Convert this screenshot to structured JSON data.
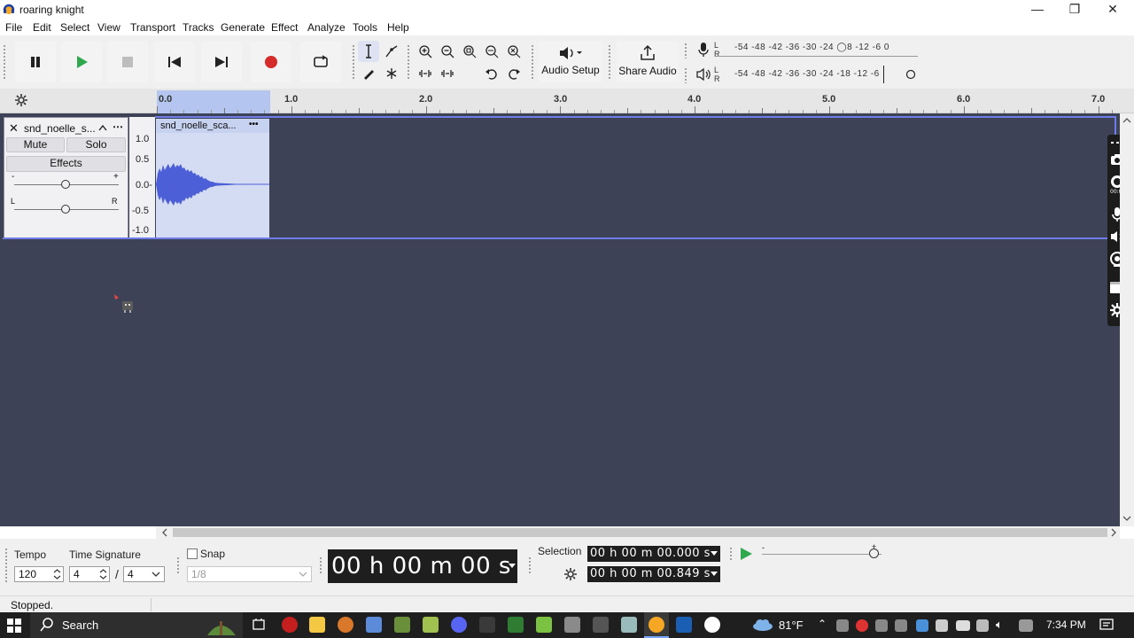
{
  "window": {
    "title": "roaring knight",
    "min": "—",
    "max": "❐",
    "close": "✕"
  },
  "menu": [
    "File",
    "Edit",
    "Select",
    "View",
    "Transport",
    "Tracks",
    "Generate",
    "Effect",
    "Analyze",
    "Tools",
    "Help"
  ],
  "toolbar": {
    "audio_setup": "Audio Setup",
    "share_audio": "Share Audio"
  },
  "meters": {
    "record": {
      "channels": "L R",
      "scale": "-54 -48 -42 -36 -30 -24 ◯8 -12 -6 0"
    },
    "playback": {
      "channels": "L R",
      "scale": "-54 -48 -42 -36 -30 -24 -18 -12 -6"
    }
  },
  "ruler": [
    "0.0",
    "1.0",
    "2.0",
    "3.0",
    "4.0",
    "5.0",
    "6.0",
    "7.0"
  ],
  "track": {
    "name": "snd_noelle_s...",
    "mute": "Mute",
    "solo": "Solo",
    "effects": "Effects",
    "gain_minus": "-",
    "gain_plus": "+",
    "pan_left": "L",
    "pan_right": "R",
    "scale": [
      "1.0",
      "0.5",
      "0.0-",
      "-0.5",
      "-1.0"
    ],
    "clip_name": "snd_noelle_sca...",
    "clip_menu": "•••"
  },
  "bottom": {
    "tempo_label": "Tempo",
    "tempo_value": "120",
    "timesig_label": "Time Signature",
    "timesig_num": "4",
    "timesig_sep": "/",
    "timesig_den": "4",
    "snap_label": "Snap",
    "snap_value": "1/8",
    "time_display": "00 h 00 m 00 s",
    "selection_label": "Selection",
    "sel_start": "00 h 00 m 00.000 s",
    "sel_end": "00 h 00 m 00.849 s"
  },
  "status": "Stopped.",
  "taskbar": {
    "search": "Search",
    "weather": "81°F",
    "clock": "7:34 PM"
  },
  "colors": {
    "track_bg": "#3e4257",
    "clip": "#d4dcf4",
    "wave": "#4d5fd6",
    "record": "#d62b2b",
    "play": "#2fa84f",
    "selection": "#b4c6ef"
  }
}
